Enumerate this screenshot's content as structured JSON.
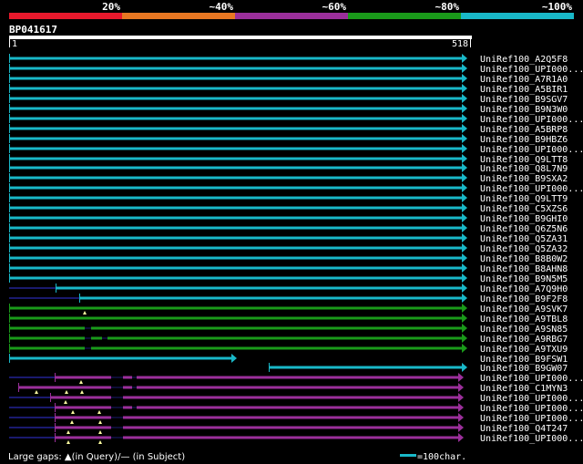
{
  "legend": {
    "segments": [
      {
        "label": "20%",
        "color": "#e8192c"
      },
      {
        "label": "~40%",
        "color": "#e87722"
      },
      {
        "label": "~60%",
        "color": "#9b2f9b"
      },
      {
        "label": "~80%",
        "color": "#1a9a1a"
      },
      {
        "label": "~100%",
        "color": "#19b8c8"
      }
    ]
  },
  "query": {
    "name": "BP041617",
    "start": "1",
    "end": "518"
  },
  "colors": {
    "cyan": "#19b8c8",
    "green": "#1a9a1a",
    "purple": "#9b2f9b",
    "navy": "#1a1a6e",
    "gap_marker": "#ffffa0"
  },
  "hits": [
    {
      "label": "UniRef100_A2Q5F8",
      "color": "cyan"
    },
    {
      "label": "UniRef100_UPI000...",
      "color": "cyan"
    },
    {
      "label": "UniRef100_A7R1A0",
      "color": "cyan"
    },
    {
      "label": "UniRef100_A5BIR1",
      "color": "cyan"
    },
    {
      "label": "UniRef100_B9SGV7",
      "color": "cyan"
    },
    {
      "label": "UniRef100_B9N3W0",
      "color": "cyan"
    },
    {
      "label": "UniRef100_UPI000...",
      "color": "cyan"
    },
    {
      "label": "UniRef100_A5BRP8",
      "color": "cyan"
    },
    {
      "label": "UniRef100_B9HBZ6",
      "color": "cyan"
    },
    {
      "label": "UniRef100_UPI000...",
      "color": "cyan"
    },
    {
      "label": "UniRef100_Q9LTT8",
      "color": "cyan"
    },
    {
      "label": "UniRef100_Q8L7N9",
      "color": "cyan"
    },
    {
      "label": "UniRef100_B9SXA2",
      "color": "cyan"
    },
    {
      "label": "UniRef100_UPI000...",
      "color": "cyan"
    },
    {
      "label": "UniRef100_Q9LTT9",
      "color": "cyan"
    },
    {
      "label": "UniRef100_C5XZS6",
      "color": "cyan"
    },
    {
      "label": "UniRef100_B9GHI0",
      "color": "cyan"
    },
    {
      "label": "UniRef100_Q6Z5N6",
      "color": "cyan"
    },
    {
      "label": "UniRef100_Q5ZA31",
      "color": "cyan"
    },
    {
      "label": "UniRef100_Q5ZA32",
      "color": "cyan"
    },
    {
      "label": "UniRef100_B8B0W2",
      "color": "cyan"
    },
    {
      "label": "UniRef100_B8AHN8",
      "color": "cyan"
    },
    {
      "label": "UniRef100_B9N5M5",
      "color": "cyan"
    },
    {
      "label": "UniRef100_A7Q9H0",
      "color": "cyan"
    },
    {
      "label": "UniRef100_B9F2F8",
      "color": "cyan"
    },
    {
      "label": "UniRef100_A9SVK7",
      "color": "green"
    },
    {
      "label": "UniRef100_A9TBL8",
      "color": "green"
    },
    {
      "label": "UniRef100_A9SN85",
      "color": "green"
    },
    {
      "label": "UniRef100_A9RBG7",
      "color": "green"
    },
    {
      "label": "UniRef100_A9TXU9",
      "color": "green"
    },
    {
      "label": "UniRef100_B9FSW1",
      "color": "cyan"
    },
    {
      "label": "UniRef100_B9GW07",
      "color": "cyan"
    },
    {
      "label": "UniRef100_UPI000...",
      "color": "purple"
    },
    {
      "label": "UniRef100_C1MYN3",
      "color": "purple"
    },
    {
      "label": "UniRef100_UPI000...",
      "color": "purple"
    },
    {
      "label": "UniRef100_UPI000...",
      "color": "purple"
    },
    {
      "label": "UniRef100_UPI000...",
      "color": "purple"
    },
    {
      "label": "UniRef100_Q4T247",
      "color": "purple"
    },
    {
      "label": "UniRef100_UPI000...",
      "color": "purple"
    }
  ],
  "footer": {
    "gaps_label": "Large gaps: ▲(in Query)/— (in Subject)",
    "scale_label": "=100char."
  }
}
